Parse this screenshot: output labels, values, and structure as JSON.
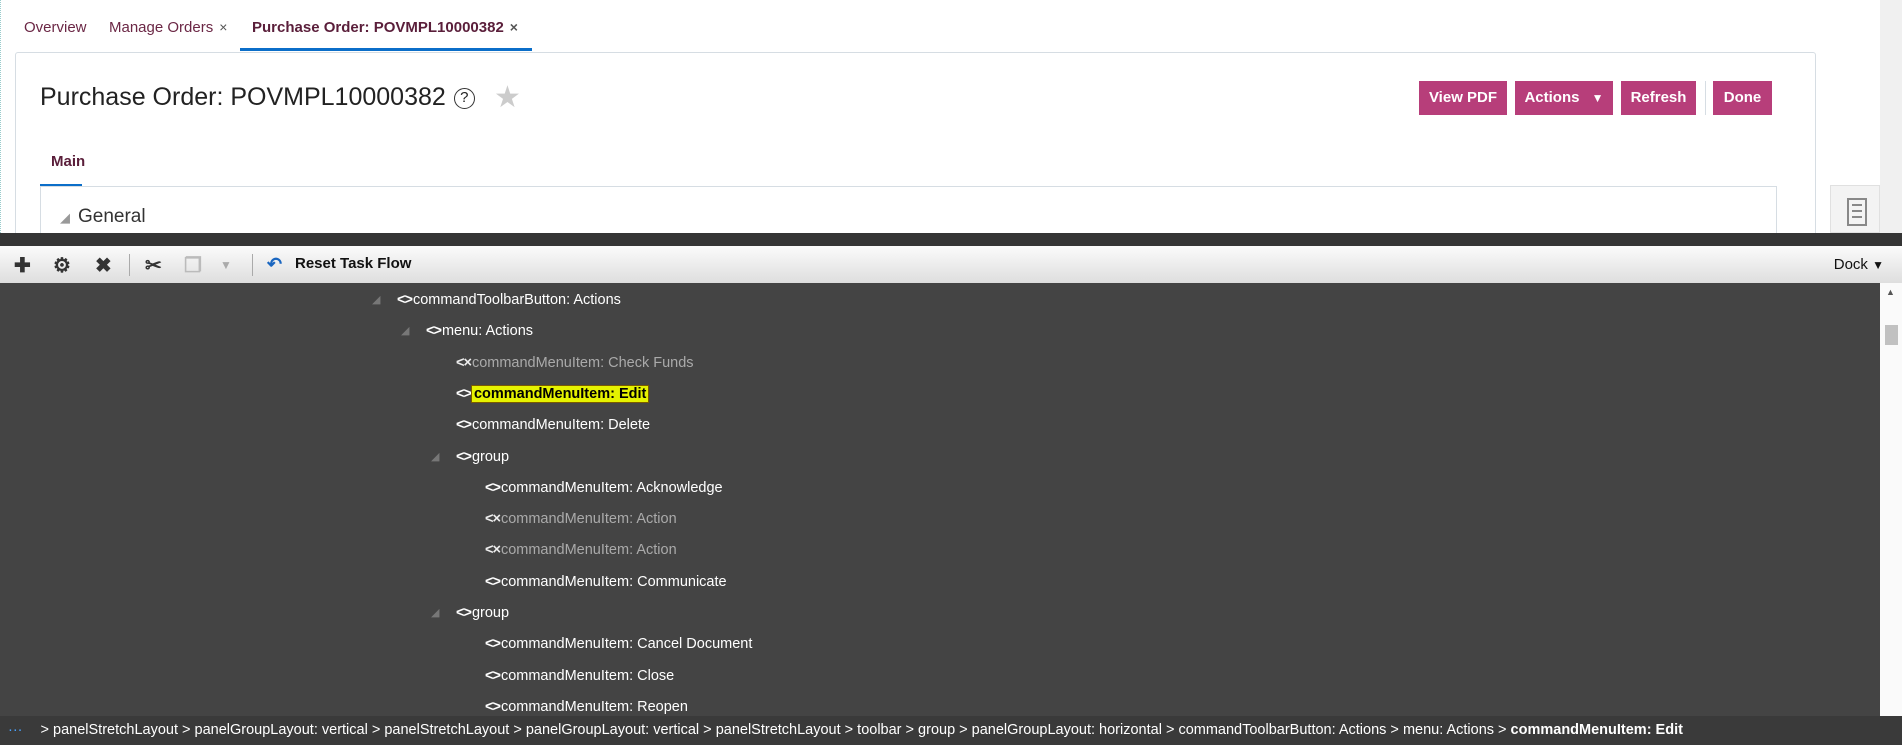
{
  "tabs": [
    {
      "label": "Overview"
    },
    {
      "label": "Manage Orders",
      "closable": true
    },
    {
      "label": "Purchase Order: POVMPL10000382",
      "closable": true,
      "active": true
    }
  ],
  "close_glyph": "×",
  "page": {
    "title": "Purchase Order: POVMPL10000382",
    "help": "?",
    "star": "★",
    "buttons": {
      "view_pdf": "View PDF",
      "actions": "Actions",
      "refresh": "Refresh",
      "done": "Done"
    },
    "subtab": "Main",
    "section": "General"
  },
  "toolbar": {
    "reset_label": "Reset Task Flow",
    "dock_label": "Dock"
  },
  "tree": [
    {
      "level": 0,
      "toggle": true,
      "label": "commandToolbarButton: Actions"
    },
    {
      "level": 1,
      "toggle": true,
      "label": "menu: Actions"
    },
    {
      "level": 2,
      "disabled": true,
      "label": "commandMenuItem: Check Funds"
    },
    {
      "level": 2,
      "selected": true,
      "label": "commandMenuItem: Edit"
    },
    {
      "level": 2,
      "label": "commandMenuItem: Delete"
    },
    {
      "level": 2,
      "toggle": true,
      "label": "group"
    },
    {
      "level": 3,
      "label": "commandMenuItem: Acknowledge"
    },
    {
      "level": 3,
      "disabled": true,
      "label": "commandMenuItem: Action"
    },
    {
      "level": 3,
      "disabled": true,
      "label": "commandMenuItem: Action"
    },
    {
      "level": 3,
      "label": "commandMenuItem: Communicate"
    },
    {
      "level": 2,
      "toggle": true,
      "label": "group"
    },
    {
      "level": 3,
      "label": "commandMenuItem: Cancel Document"
    },
    {
      "level": 3,
      "label": "commandMenuItem: Close"
    },
    {
      "level": 3,
      "label": "commandMenuItem: Reopen"
    }
  ],
  "breadcrumb": {
    "more": "···",
    "items": [
      "panelStretchLayout",
      "panelGroupLayout: vertical",
      "panelStretchLayout",
      "panelGroupLayout: vertical",
      "panelStretchLayout",
      "toolbar",
      "group",
      "panelGroupLayout: horizontal",
      "commandToolbarButton: Actions",
      "menu: Actions"
    ],
    "current": "commandMenuItem: Edit"
  },
  "colors": {
    "brand": "#b73e7a",
    "accent": "#0b6ec9",
    "highlight": "#e5f200"
  }
}
